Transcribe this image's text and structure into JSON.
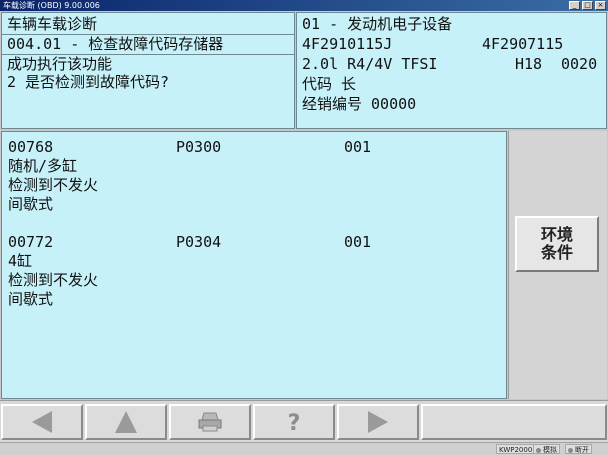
{
  "window": {
    "title": "车载诊断 (OBD) 9.00.006",
    "minimize": "_",
    "maximize": "□",
    "close": "×"
  },
  "header_left": {
    "title": "车辆车载诊断",
    "function": "004.01 - 检查故障代码存储器",
    "message_1": "成功执行该功能",
    "message_2": "2 是否检测到故障代码?"
  },
  "header_right": {
    "module": "01 - 发动机电子设备",
    "part_no_1": "4F2910115J",
    "part_no_2": "4F2907115",
    "engine": "2.0l R4/4V TFSI",
    "hw": "H18",
    "sw": "0020",
    "coding": "代码 长",
    "dealer": "经销编号 00000"
  },
  "faults": [
    {
      "code": "00768",
      "pcode": "P0300",
      "status": "001",
      "line1": "随机/多缸",
      "line2": "检测到不发火",
      "line3": "间歇式"
    },
    {
      "code": "00772",
      "pcode": "P0304",
      "status": "001",
      "line1": "4缸",
      "line2": "检测到不发火",
      "line3": "间歇式"
    }
  ],
  "side": {
    "env_line1": "环境",
    "env_line2": "条件"
  },
  "toolbar": {
    "icons": [
      "arrow-left-icon",
      "arrow-up-icon",
      "printer-icon",
      "help-icon",
      "arrow-right-icon"
    ],
    "help_glyph": "?"
  },
  "status": {
    "mode": "KWP2000",
    "sim": "模拟",
    "disconnect": "断开"
  },
  "colors": {
    "panel": "#c7f1f8",
    "accent": "#b7e3f2",
    "icon": "#9a9a9a"
  }
}
